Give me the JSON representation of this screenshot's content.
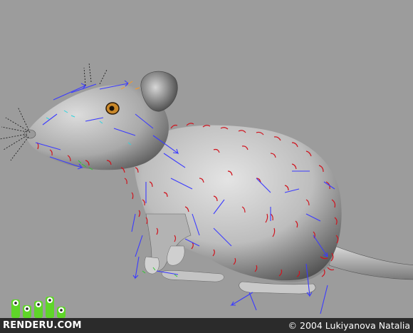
{
  "watermark": {
    "logo_text": "RENDERU.COM",
    "copyright": "© 2004 Lukiyanova Natalia"
  },
  "colors": {
    "background": "#9c9c9c",
    "footer": "#2b2b2b",
    "logo_green": "#5fd629",
    "fur_red": "#d0141e",
    "guide_blue": "#3b3bff"
  },
  "icons": [
    "renderu-logo-icon",
    "rat-model-render"
  ]
}
